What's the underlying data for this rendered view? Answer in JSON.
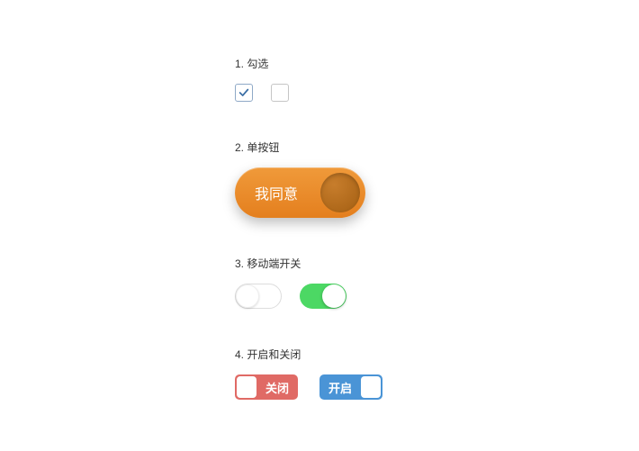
{
  "sections": {
    "checkbox": {
      "title": "1. 勾选",
      "item1_checked": true,
      "item2_checked": false
    },
    "big_button": {
      "title": "2. 单按钮",
      "label": "我同意"
    },
    "mobile_toggle": {
      "title": "3. 移动端开关",
      "toggle1_on": false,
      "toggle2_on": true
    },
    "labeled_switch": {
      "title": "4. 开启和关闭",
      "off_label": "关闭",
      "on_label": "开启"
    }
  },
  "colors": {
    "orange_button": "#e8861f",
    "toggle_green": "#4cd864",
    "switch_red": "#e06a65",
    "switch_blue": "#4a94d6"
  }
}
